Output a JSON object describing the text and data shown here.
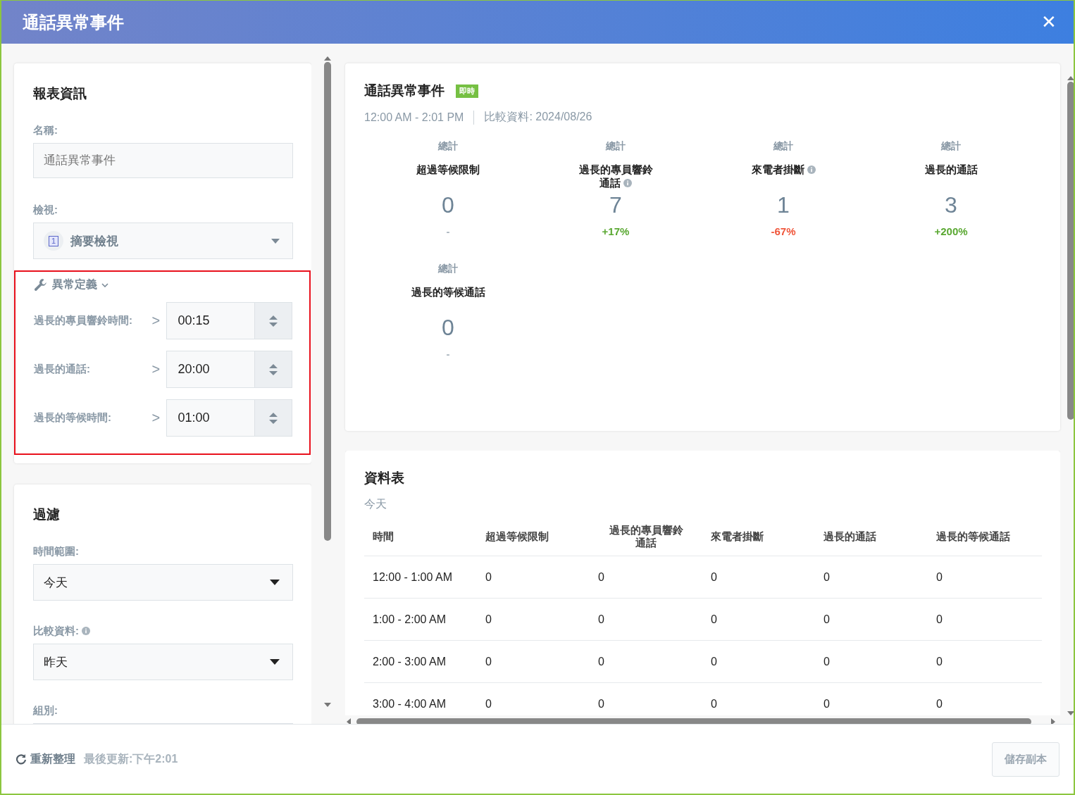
{
  "window": {
    "title": "通話異常事件",
    "close": "✕"
  },
  "report_info": {
    "heading": "報表資訊",
    "name_label": "名稱:",
    "name_placeholder": "通話異常事件",
    "view_label": "檢視:",
    "view_badge": "1",
    "view_value": "摘要檢視"
  },
  "anomaly": {
    "label": "異常定義",
    "expanded": true,
    "highlighted": true,
    "rows": [
      {
        "label": "過長的專員響鈴時間:",
        "operator": ">",
        "value": "00:15"
      },
      {
        "label": "過長的通話:",
        "operator": ">",
        "value": "20:00"
      },
      {
        "label": "過長的等候時間:",
        "operator": ">",
        "value": "01:00"
      }
    ]
  },
  "filter": {
    "heading": "過濾",
    "fields": [
      {
        "label": "時間範圍:",
        "value": "今天",
        "info": false
      },
      {
        "label": "比較資料:",
        "value": "昨天",
        "info": true
      },
      {
        "label": "組別:",
        "info": false
      }
    ]
  },
  "summary": {
    "title": "通話異常事件",
    "badge": "即時",
    "range": "12:00 AM - 2:01 PM",
    "compare": "比較資料: 2024/08/26",
    "metrics": [
      {
        "caption": "總計",
        "name": "超過等候限制",
        "info": false,
        "value": "0",
        "change": "-",
        "color": "#a9b4bd"
      },
      {
        "caption": "總計",
        "name": "過長的專員響鈴通話",
        "info": true,
        "value": "7",
        "change": "+17%",
        "color": "#5aa832"
      },
      {
        "caption": "總計",
        "name": "來電者掛斷",
        "info": true,
        "value": "1",
        "change": "-67%",
        "color": "#f0553a"
      },
      {
        "caption": "總計",
        "name": "過長的通話",
        "info": false,
        "value": "3",
        "change": "+200%",
        "color": "#5aa832"
      },
      {
        "caption": "總計",
        "name": "過長的等候通話",
        "info": false,
        "value": "0",
        "change": "-",
        "color": "#a9b4bd"
      }
    ]
  },
  "table": {
    "heading": "資料表",
    "subtitle": "今天",
    "columns": [
      "時間",
      "超過等候限制",
      "過長的專員響鈴通話",
      "來電者掛斷",
      "過長的通話",
      "過長的等候通話"
    ],
    "rows": [
      [
        "12:00 - 1:00 AM",
        "0",
        "0",
        "0",
        "0",
        "0"
      ],
      [
        "1:00 - 2:00 AM",
        "0",
        "0",
        "0",
        "0",
        "0"
      ],
      [
        "2:00 - 3:00 AM",
        "0",
        "0",
        "0",
        "0",
        "0"
      ],
      [
        "3:00 - 4:00 AM",
        "0",
        "0",
        "0",
        "0",
        "0"
      ]
    ]
  },
  "footer": {
    "refresh": "重新整理",
    "last_updated": "最後更新:下午2:01",
    "save": "儲存副本",
    "save_disabled": true
  }
}
